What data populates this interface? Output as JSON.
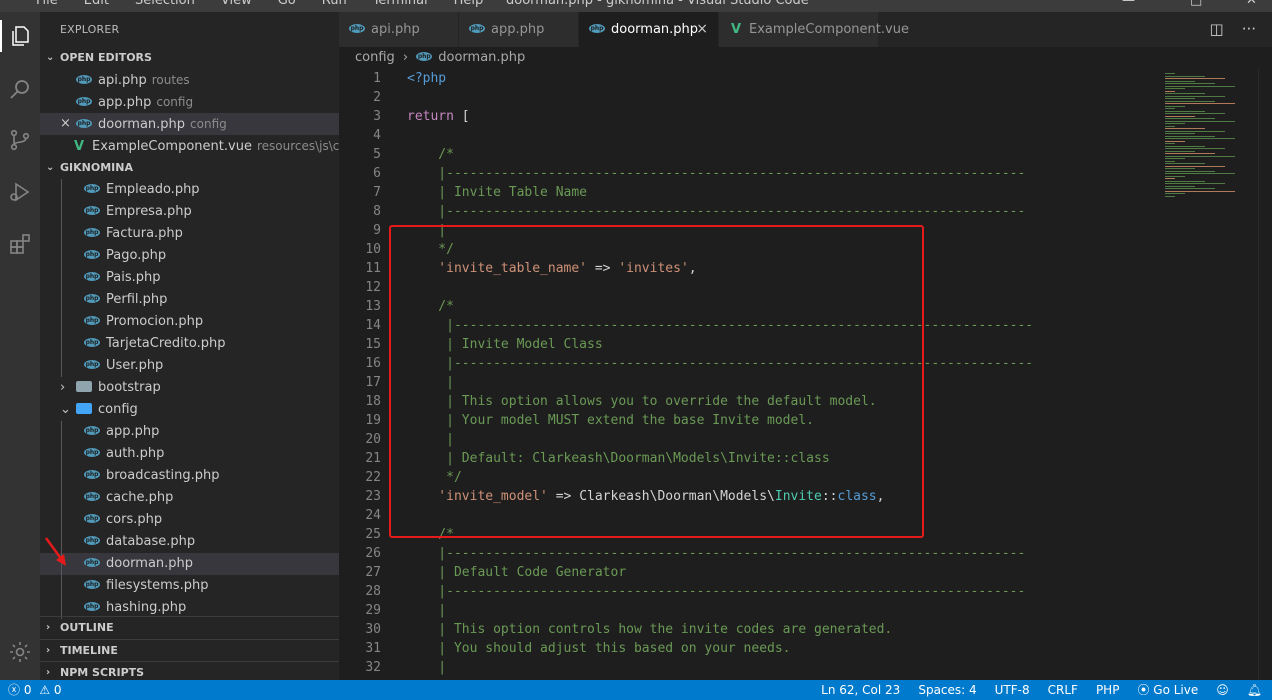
{
  "window": {
    "title": "doorman.php - giknomina - Visual Studio Code",
    "menu": [
      "File",
      "Edit",
      "Selection",
      "View",
      "Go",
      "Run",
      "Terminal",
      "Help"
    ]
  },
  "sidebar": {
    "title": "EXPLORER",
    "open_editors": {
      "label": "OPEN EDITORS",
      "items": [
        {
          "name": "api.php",
          "desc": "routes",
          "icon": "php"
        },
        {
          "name": "app.php",
          "desc": "config",
          "icon": "php"
        },
        {
          "name": "doorman.php",
          "desc": "config",
          "icon": "php",
          "selected": true,
          "close": "×"
        },
        {
          "name": "ExampleComponent.vue",
          "desc": "resources\\js\\com...",
          "icon": "vue"
        }
      ]
    },
    "project": {
      "label": "GIKNOMINA",
      "models": [
        "Empleado.php",
        "Empresa.php",
        "Factura.php",
        "Pago.php",
        "Pais.php",
        "Perfil.php",
        "Promocion.php",
        "TarjetaCredito.php",
        "User.php"
      ],
      "bootstrap": "bootstrap",
      "config": "config",
      "config_files": [
        "app.php",
        "auth.php",
        "broadcasting.php",
        "cache.php",
        "cors.php",
        "database.php",
        "doorman.php",
        "filesystems.php",
        "hashing.php"
      ]
    },
    "outline": "OUTLINE",
    "timeline": "TIMELINE",
    "npm": "NPM SCRIPTS"
  },
  "tabs": [
    {
      "label": "api.php",
      "icon": "php"
    },
    {
      "label": "app.php",
      "icon": "php"
    },
    {
      "label": "doorman.php",
      "icon": "php",
      "active": true,
      "close": "×"
    },
    {
      "label": "ExampleComponent.vue",
      "icon": "vue"
    }
  ],
  "breadcrumb": {
    "folder": "config",
    "sep": "›",
    "file": "doorman.php"
  },
  "editor": {
    "lines": [
      [
        [
          "c-kw",
          "<?php"
        ]
      ],
      [],
      [
        [
          "c-ctrl",
          "return"
        ],
        [
          "c-pl",
          " ["
        ]
      ],
      [],
      [
        [
          "c-cm",
          "    /*"
        ]
      ],
      [
        [
          "c-cm",
          "    |--------------------------------------------------------------------------"
        ]
      ],
      [
        [
          "c-cm",
          "    | Invite Table Name"
        ]
      ],
      [
        [
          "c-cm",
          "    |--------------------------------------------------------------------------"
        ]
      ],
      [
        [
          "c-cm",
          "    |"
        ]
      ],
      [
        [
          "c-cm",
          "    */"
        ]
      ],
      [
        [
          "c-str",
          "    'invite_table_name'"
        ],
        [
          "c-pl",
          " => "
        ],
        [
          "c-str",
          "'invites'"
        ],
        [
          "c-pl",
          ","
        ]
      ],
      [],
      [
        [
          "c-cm",
          "    /*"
        ]
      ],
      [
        [
          "c-cm",
          "     |--------------------------------------------------------------------------"
        ]
      ],
      [
        [
          "c-cm",
          "     | Invite Model Class"
        ]
      ],
      [
        [
          "c-cm",
          "     |--------------------------------------------------------------------------"
        ]
      ],
      [
        [
          "c-cm",
          "     |"
        ]
      ],
      [
        [
          "c-cm",
          "     | This option allows you to override the default model."
        ]
      ],
      [
        [
          "c-cm",
          "     | Your model MUST extend the base Invite model."
        ]
      ],
      [
        [
          "c-cm",
          "     |"
        ]
      ],
      [
        [
          "c-cm",
          "     | Default: Clarkeash\\Doorman\\Models\\Invite::class"
        ]
      ],
      [
        [
          "c-cm",
          "     */"
        ]
      ],
      [
        [
          "c-str",
          "    'invite_model'"
        ],
        [
          "c-pl",
          " => Clarkeash\\Doorman\\Models\\"
        ],
        [
          "c-cls",
          "Invite"
        ],
        [
          "c-pl",
          "::"
        ],
        [
          "c-cn",
          "class"
        ],
        [
          "c-pl",
          ","
        ]
      ],
      [],
      [
        [
          "c-cm",
          "    /*"
        ]
      ],
      [
        [
          "c-cm",
          "    |--------------------------------------------------------------------------"
        ]
      ],
      [
        [
          "c-cm",
          "    | Default Code Generator"
        ]
      ],
      [
        [
          "c-cm",
          "    |--------------------------------------------------------------------------"
        ]
      ],
      [
        [
          "c-cm",
          "    |"
        ]
      ],
      [
        [
          "c-cm",
          "    | This option controls how the invite codes are generated."
        ]
      ],
      [
        [
          "c-cm",
          "    | You should adjust this based on your needs."
        ]
      ],
      [
        [
          "c-cm",
          "    |"
        ]
      ],
      [
        [
          "c-cm",
          "    |"
        ]
      ]
    ]
  },
  "status": {
    "errors": "0",
    "warnings": "0",
    "cursor": "Ln 62, Col 23",
    "spaces": "Spaces: 4",
    "encoding": "UTF-8",
    "eol": "CRLF",
    "language": "PHP",
    "golive": "Go Live"
  },
  "colors": {
    "accent": "#007acc",
    "highlight": "#e51b1b"
  }
}
